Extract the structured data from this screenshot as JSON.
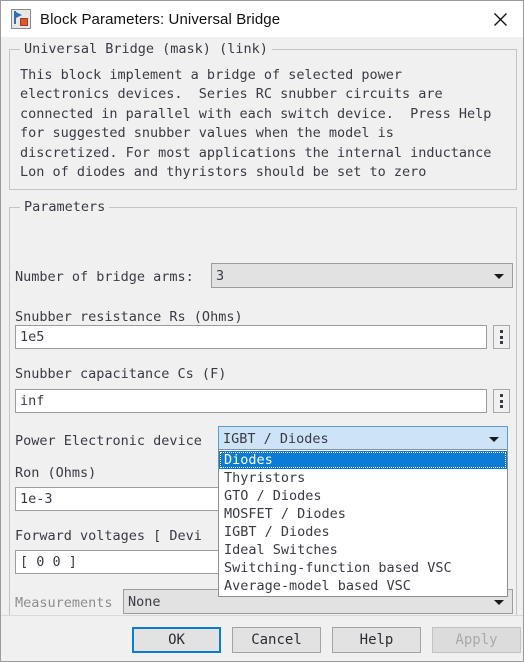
{
  "window": {
    "title": "Block Parameters: Universal Bridge",
    "icon": "simulink-block-icon",
    "close_label": "close-icon"
  },
  "description": {
    "group_title": "Universal Bridge (mask) (link)",
    "text": "This block implement a bridge of selected power\nelectronics devices.  Series RC snubber circuits are\nconnected in parallel with each switch device.  Press Help\nfor suggested snubber values when the model is\ndiscretized. For most applications the internal inductance\nLon of diodes and thyristors should be set to zero"
  },
  "parameters": {
    "group_title": "Parameters",
    "bridge_arms": {
      "label": "Number of bridge arms:",
      "value": "3"
    },
    "snubber_resistance": {
      "label": "Snubber resistance Rs (Ohms)",
      "value": "1e5"
    },
    "snubber_capacitance": {
      "label": "Snubber capacitance Cs (F)",
      "value": "inf"
    },
    "power_device": {
      "label": "Power Electronic device",
      "value": "IGBT / Diodes",
      "options": [
        "Diodes",
        "Thyristors",
        "GTO / Diodes",
        "MOSFET / Diodes",
        "IGBT / Diodes",
        "Ideal Switches",
        "Switching-function based VSC",
        "Average-model based VSC"
      ],
      "highlighted_option": "Diodes"
    },
    "ron": {
      "label": "Ron (Ohms)",
      "value": "1e-3"
    },
    "forward_voltages": {
      "label": "Forward voltages  [ Devi",
      "value": "[  0   0  ]"
    },
    "measurements": {
      "label": "Measurements",
      "value": "None"
    }
  },
  "buttons": {
    "ok": "OK",
    "cancel": "Cancel",
    "help": "Help",
    "apply": "Apply"
  },
  "colors": {
    "dialog_bg": "#f0f0f0",
    "accent_blue": "#0a7cd8",
    "combo_open_bg": "#cde3f7",
    "text": "#3a3a44"
  }
}
